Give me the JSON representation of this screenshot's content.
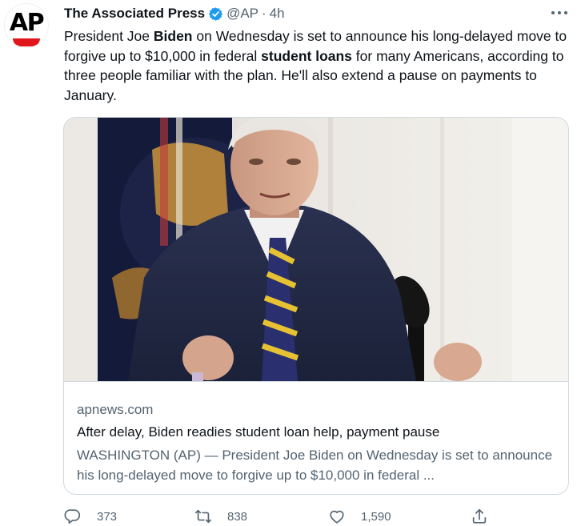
{
  "tweet": {
    "author_name": "The Associated Press",
    "avatar_text": "AP",
    "handle": "@AP",
    "separator": "·",
    "time": "4h",
    "text": {
      "p1": "President Joe ",
      "b1": "Biden",
      "p2": " on Wednesday is set to announce his long-delayed move to forgive up to $10,000 in federal ",
      "b2": "student loans",
      "p3": " for many Americans, according to three people familiar with the plan. He'll also extend a pause on payments to January."
    }
  },
  "card": {
    "domain": "apnews.com",
    "title": "After delay, Biden readies student loan help, payment pause",
    "description": "WASHINGTON (AP) — President Joe Biden on Wednesday is set to announce his long-delayed move to forgive up to $10,000 in federal ..."
  },
  "actions": {
    "replies": "373",
    "retweets": "838",
    "likes": "1,590"
  },
  "colors": {
    "brand_red": "#e0161b",
    "verified_blue": "#1d9bf0",
    "secondary_text": "#536471",
    "primary_text": "#0f1419",
    "border": "#cfd9de"
  },
  "icons": [
    "verified-badge-icon",
    "more-icon",
    "reply-icon",
    "retweet-icon",
    "like-icon",
    "share-icon"
  ]
}
